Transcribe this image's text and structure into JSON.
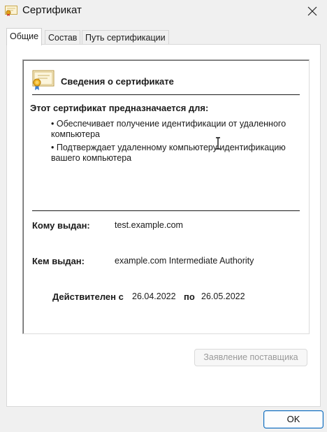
{
  "window": {
    "title": "Сертификат",
    "icon": "certificate-icon",
    "close_icon": "close-icon"
  },
  "tabs": [
    {
      "label": "Общие",
      "active": true
    },
    {
      "label": "Состав",
      "active": false
    },
    {
      "label": "Путь сертификации",
      "active": false
    }
  ],
  "general": {
    "header_title": "Сведения о сертификате",
    "purpose_title": "Этот сертификат предназначается для:",
    "purposes": [
      "Обеспечивает получение идентификации от удаленного компьютера",
      "Подтверждает удаленному компьютеру идентификацию вашего компьютера"
    ],
    "issued_to_label": "Кому выдан:",
    "issued_to_value": "test.example.com",
    "issued_by_label": "Кем выдан:",
    "issued_by_value": "example.com Intermediate Authority",
    "valid_from_label": "Действителен с",
    "valid_from_value": "26.04.2022",
    "valid_to_label": "по",
    "valid_to_value": "26.05.2022"
  },
  "buttons": {
    "issuer_statement": "Заявление поставщика",
    "issuer_statement_enabled": false,
    "ok": "OK"
  },
  "colors": {
    "accent": "#0f6cbd",
    "disabled_text": "#9a9a9a"
  }
}
